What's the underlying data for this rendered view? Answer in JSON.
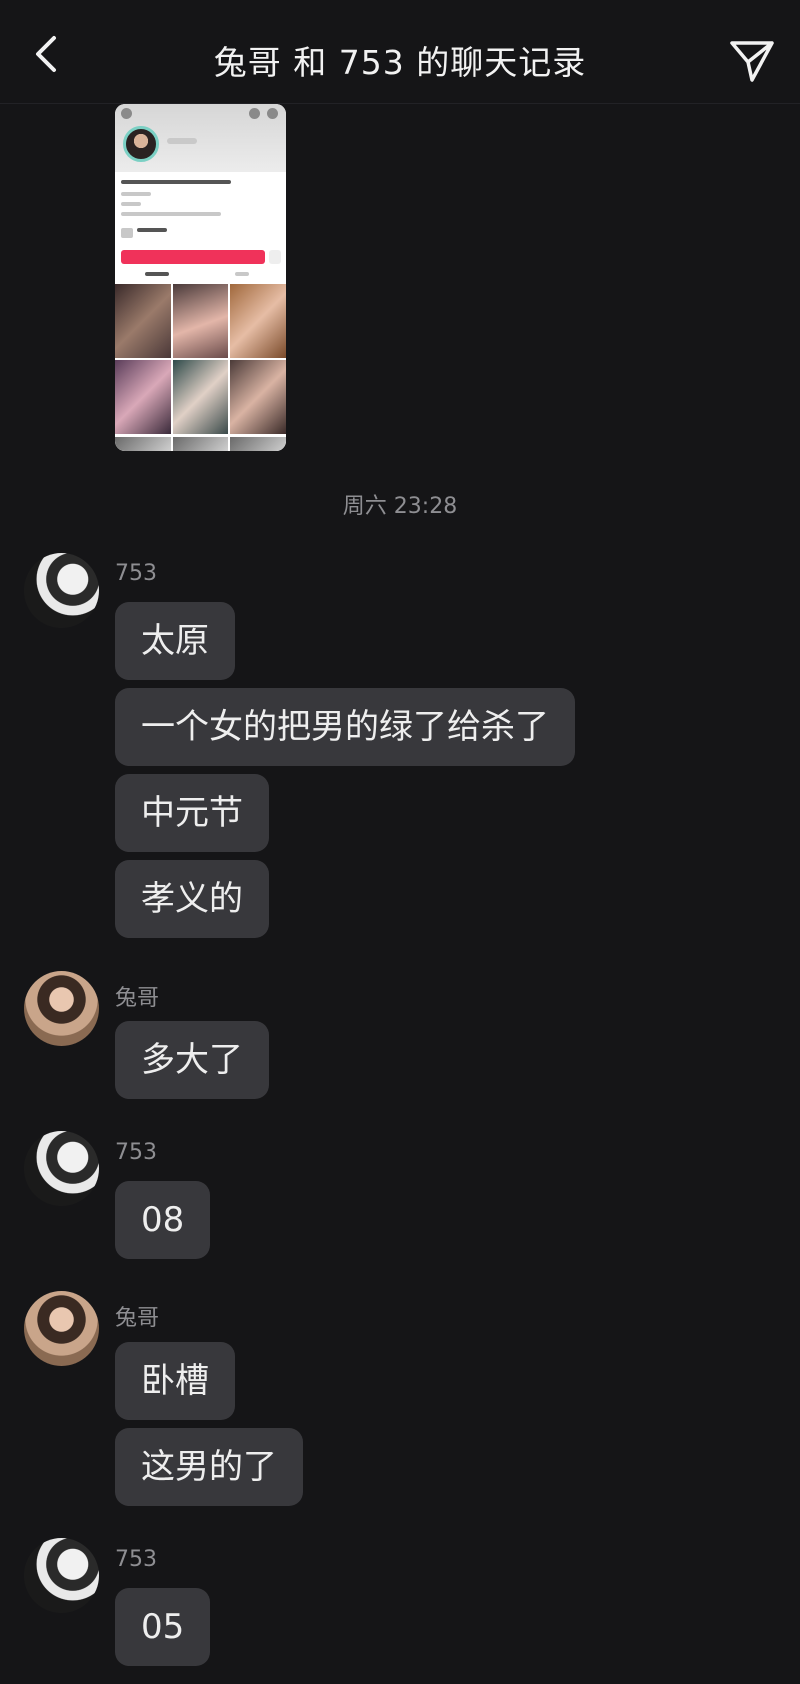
{
  "header": {
    "title": "兔哥 和 753 的聊天记录"
  },
  "chat": {
    "timestamp": "周六 23:28",
    "groups": [
      {
        "sender": "753",
        "messages": [
          "太原",
          "一个女的把男的绿了给杀了",
          "中元节",
          "孝义的"
        ]
      },
      {
        "sender": "兔哥",
        "messages": [
          "多大了"
        ]
      },
      {
        "sender": "753",
        "messages": [
          "08"
        ]
      },
      {
        "sender": "兔哥",
        "messages": [
          "卧槽",
          "这男的了"
        ]
      },
      {
        "sender": "753",
        "messages": [
          "05"
        ]
      }
    ]
  },
  "icons": {
    "back": "chevron-left-icon",
    "share": "send-icon"
  },
  "colors": {
    "background": "#151517",
    "bubble": "#38383c",
    "secondary_text": "#8e8e92",
    "accent_follow": "#f0325a"
  }
}
